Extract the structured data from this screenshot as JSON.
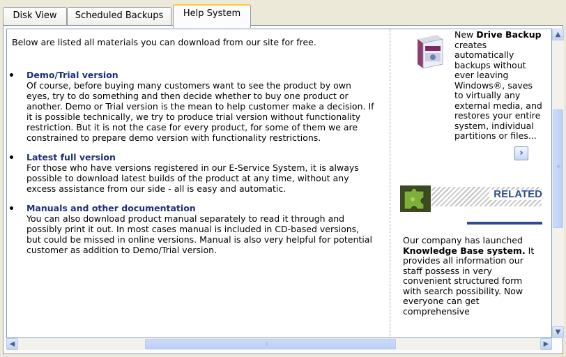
{
  "tabs": [
    "Disk View",
    "Scheduled Backups",
    "Help System"
  ],
  "active_tab": "Help System",
  "main": {
    "intro": "Below are listed all materials you can download from our site for free.",
    "items": [
      {
        "title": "Demo/Trial version",
        "text": "Of course, before buying many customers want to see the product by own eyes, try to do something and then decide whether to buy one product or another. Demo or Trial version is the mean to help customer make a decision. If it is possible technically, we try to produce trial version without functionality restriction. But it is not the case for every product, for some of them we are constrained to prepare demo version with functionality restrictions."
      },
      {
        "title": "Latest full version",
        "text": "For those who have versions registered in our E-Service System, it is always possible to download latest builds of the product at any time, without any excess assistance from our side - all is easy and automatic."
      },
      {
        "title": "Manuals and other documentation",
        "text": "You can also download product manual separately to read it through and possibly print it out. In most cases manual is included in CD-based versions, but could be missed in online versions. Manual is also very helpful for potential customer as addition to Demo/Trial version."
      }
    ]
  },
  "side": {
    "promo_prefix": "New ",
    "promo_bold": "Drive Backup",
    "promo_rest": " creates automatically backups without ever leaving Windows®, saves to virtually any external media, and restores your entire system, individual partitions or files...",
    "more_icon": "chevron-right",
    "related_label": "RELATED",
    "related_prefix": "Our company has launched ",
    "related_bold": "Knowledge Base system.",
    "related_rest": " It provides all information our staff possess in very convenient structured form with search possibility. Now everyone can get comprehensive"
  },
  "scrollbars": {
    "vertical_position": 0.2,
    "horizontal_position": 0.1
  }
}
